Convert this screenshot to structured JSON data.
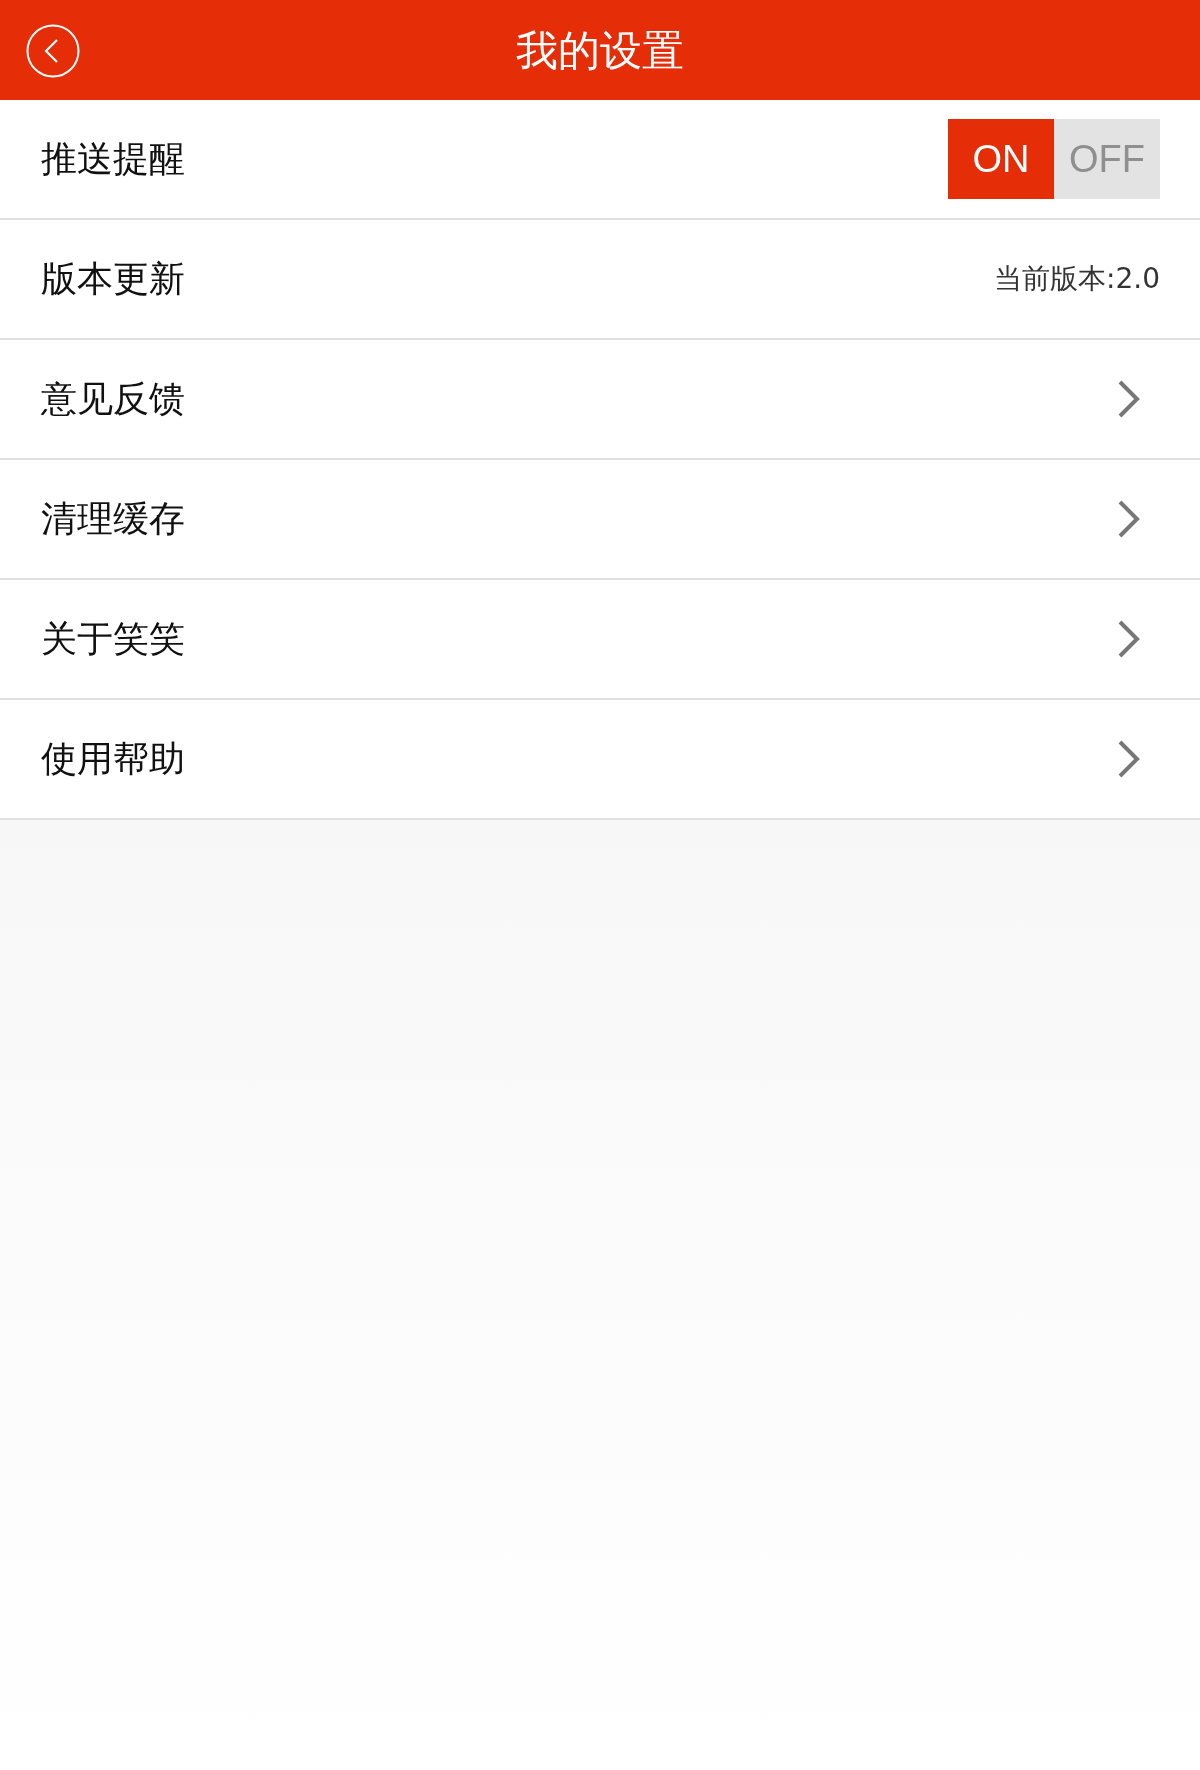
{
  "header": {
    "title": "我的设置"
  },
  "settings": [
    {
      "kind": "toggle",
      "label": "推送提醒",
      "on": true,
      "on_label": "ON",
      "off_label": "OFF"
    },
    {
      "kind": "info",
      "label": "版本更新",
      "value": "当前版本:2.0"
    },
    {
      "kind": "link",
      "label": "意见反馈"
    },
    {
      "kind": "link",
      "label": "清理缓存"
    },
    {
      "kind": "link",
      "label": "关于笑笑"
    },
    {
      "kind": "link",
      "label": "使用帮助"
    }
  ]
}
